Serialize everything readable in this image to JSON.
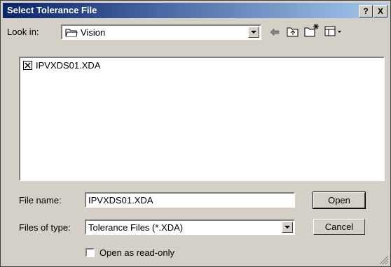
{
  "window": {
    "title": "Select Tolerance File",
    "help_label": "?",
    "close_label": "X"
  },
  "toolbar": {
    "look_in_label": "Look in:",
    "look_in_value": "Vision",
    "back_icon": "back-arrow-icon",
    "up_icon": "up-folder-icon",
    "new_folder_icon": "new-folder-icon",
    "view_icon": "view-menu-icon"
  },
  "files": [
    {
      "name": "IPVXDS01.XDA",
      "icon": "xda-file-icon"
    }
  ],
  "form": {
    "filename_label": "File name:",
    "filename_value": "IPVXDS01.XDA",
    "filetype_label": "Files of type:",
    "filetype_value": "Tolerance Files (*.XDA)",
    "readonly_label": "Open as read-only",
    "readonly_checked": false
  },
  "buttons": {
    "open": "Open",
    "cancel": "Cancel"
  }
}
